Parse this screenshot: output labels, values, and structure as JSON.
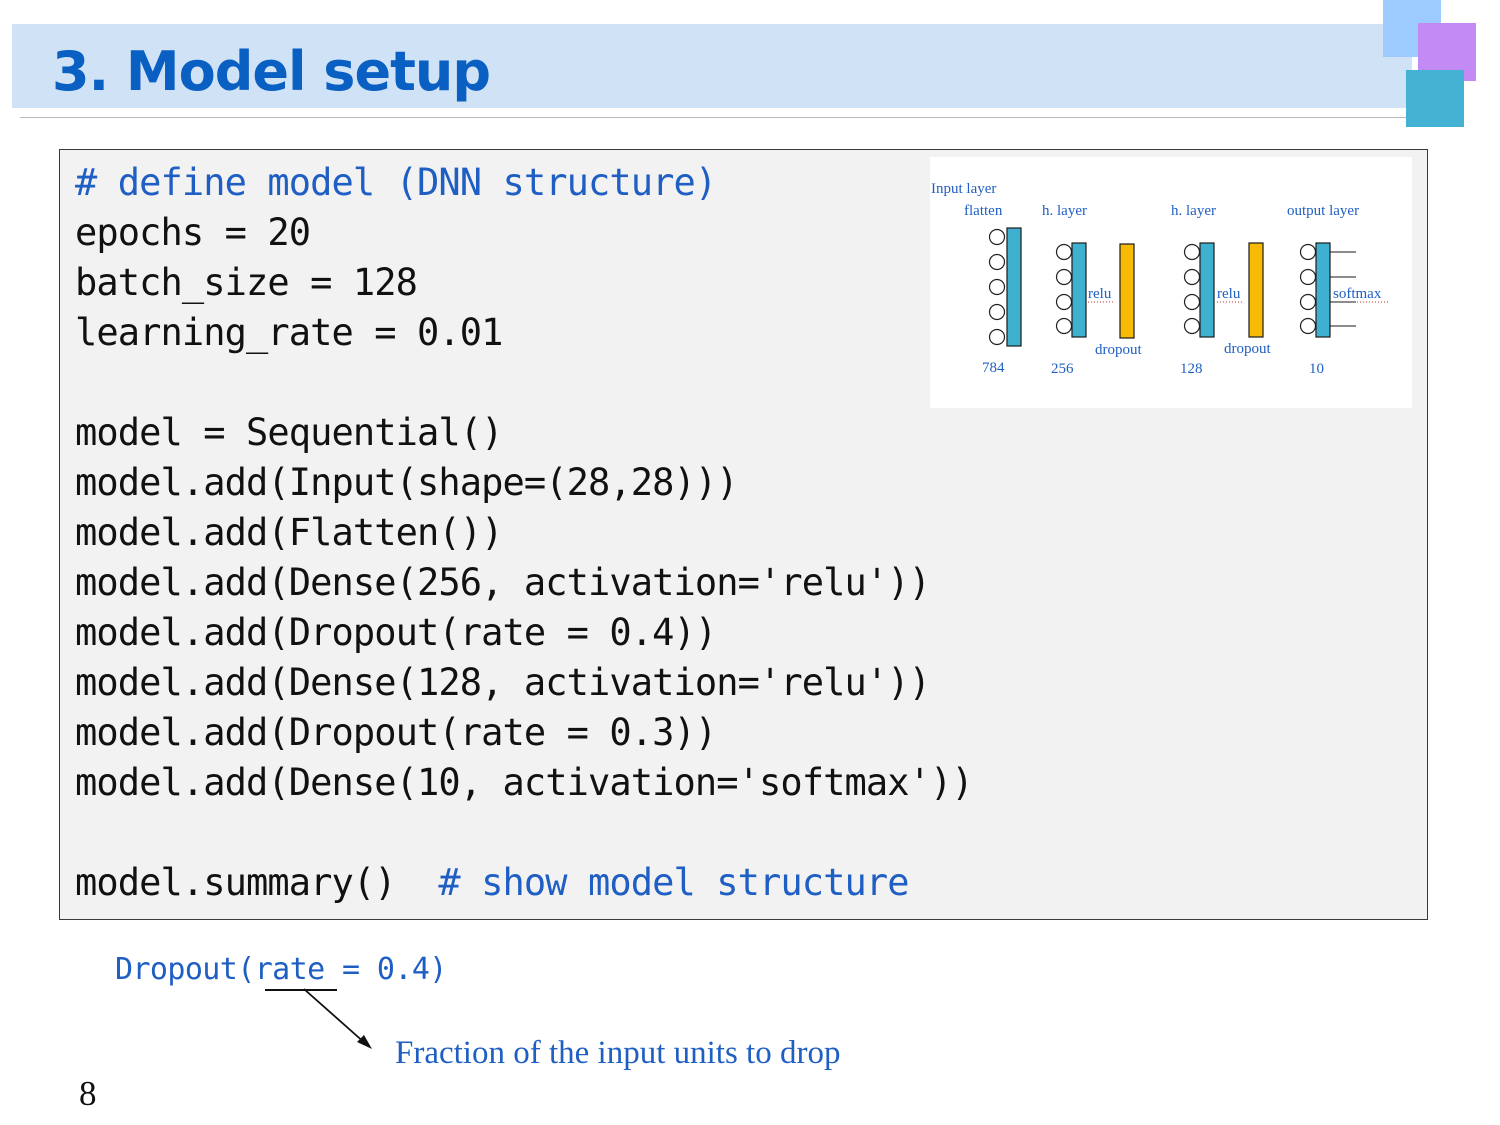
{
  "slide": {
    "title": "3. Model setup",
    "page_number": "8"
  },
  "code": {
    "lines": [
      {
        "text": "# define model (DNN structure)",
        "kind": "comment"
      },
      {
        "text": "epochs = 20",
        "kind": "code"
      },
      {
        "text": "batch_size = 128",
        "kind": "code"
      },
      {
        "text": "learning_rate = 0.01",
        "kind": "code"
      },
      {
        "text": "",
        "kind": "blank"
      },
      {
        "text": "model = Sequential()",
        "kind": "code"
      },
      {
        "text": "model.add(Input(shape=(28,28)))",
        "kind": "code"
      },
      {
        "text": "model.add(Flatten())",
        "kind": "code"
      },
      {
        "text": "model.add(Dense(256, activation='relu'))",
        "kind": "code"
      },
      {
        "text": "model.add(Dropout(rate = 0.4))",
        "kind": "code"
      },
      {
        "text": "model.add(Dense(128, activation='relu'))",
        "kind": "code"
      },
      {
        "text": "model.add(Dropout(rate = 0.3))",
        "kind": "code"
      },
      {
        "text": "model.add(Dense(10, activation='softmax'))",
        "kind": "code"
      },
      {
        "text": "",
        "kind": "blank"
      },
      {
        "text": "model.summary()",
        "kind": "code",
        "comment": "# show model structure"
      }
    ]
  },
  "diagram": {
    "labels": {
      "input_layer": "Input layer",
      "flatten": "flatten",
      "hidden1": "h. layer",
      "hidden2": "h. layer",
      "output_layer": "output layer",
      "relu1": "relu",
      "relu2": "relu",
      "softmax": "softmax",
      "dropout1": "dropout",
      "dropout2": "dropout"
    },
    "sizes": [
      "784",
      "256",
      "128",
      "10"
    ],
    "colors": {
      "dense": "#3fb0d0",
      "dropout": "#f7bb06",
      "text": "#1f5fc4"
    }
  },
  "note": {
    "code": "Dropout(rate = 0.4)",
    "explanation": "Fraction of the input units to drop"
  }
}
